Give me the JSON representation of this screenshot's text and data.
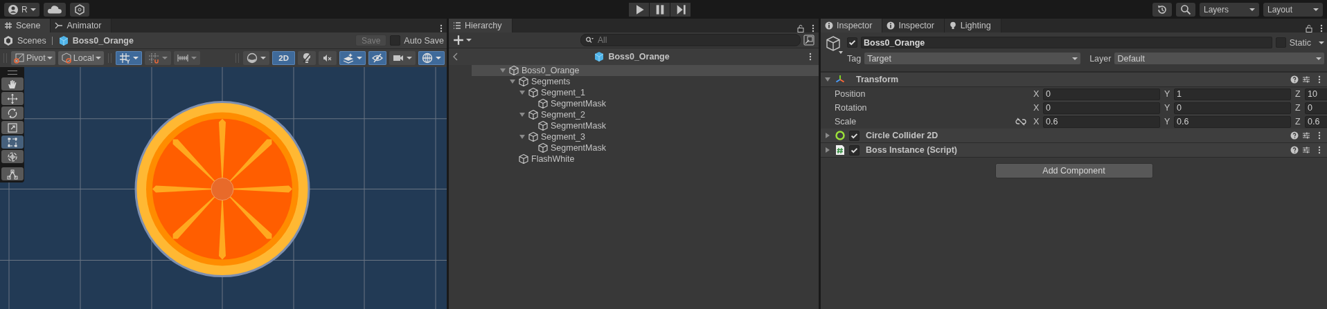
{
  "top_bar": {
    "account": "R",
    "layers": "Layers",
    "layout": "Layout"
  },
  "scene": {
    "tabs": [
      {
        "label": "Scene",
        "kind": "grid",
        "selected": true
      },
      {
        "label": "Animator",
        "kind": "animator",
        "selected": false
      }
    ],
    "breadcrumb": [
      "Scenes",
      "Boss0_Orange"
    ],
    "save": "Save",
    "auto_save": {
      "label": "Auto Save",
      "checked": false
    },
    "pivot": "Pivot",
    "local": "Local",
    "snap_toggles": [
      {
        "kind": "grid-snap",
        "on": true
      },
      {
        "kind": "increment-snap",
        "on": false
      },
      {
        "kind": "grid-ruler",
        "on": false
      }
    ],
    "view_toggles": [
      {
        "kind": "shading",
        "on": false
      },
      {
        "kind": "mode",
        "label": "2D",
        "on": true
      },
      {
        "kind": "lighting",
        "on": false
      },
      {
        "kind": "audio",
        "on": false
      },
      {
        "kind": "effects",
        "on": true
      },
      {
        "kind": "visibility",
        "on": true
      },
      {
        "kind": "camera",
        "on": false
      },
      {
        "kind": "gizmos",
        "on": true
      }
    ],
    "tools": [
      {
        "kind": "hand",
        "selected": false
      },
      {
        "kind": "move",
        "selected": false
      },
      {
        "kind": "rotate",
        "selected": false
      },
      {
        "kind": "scale",
        "selected": false
      },
      {
        "kind": "rect",
        "selected": true
      },
      {
        "kind": "transform",
        "selected": false
      },
      {
        "kind": "custom",
        "selected": false
      }
    ]
  },
  "hierarchy": {
    "tabs": [
      {
        "label": "Hierarchy",
        "selected": true
      }
    ],
    "search": {
      "placeholder": "All"
    },
    "prefab_title": "Boss0_Orange",
    "tree": [
      {
        "name": "Boss0_Orange",
        "selected": true,
        "expanded": true,
        "children": [
          {
            "name": "Segments",
            "selected": false,
            "expanded": true,
            "children": [
              {
                "name": "Segment_1",
                "selected": false,
                "expanded": true,
                "children": [
                  {
                    "name": "SegmentMask",
                    "selected": false
                  }
                ]
              },
              {
                "name": "Segment_2",
                "selected": false,
                "expanded": true,
                "children": [
                  {
                    "name": "SegmentMask",
                    "selected": false
                  }
                ]
              },
              {
                "name": "Segment_3",
                "selected": false,
                "expanded": true,
                "children": [
                  {
                    "name": "SegmentMask",
                    "selected": false
                  }
                ]
              }
            ]
          },
          {
            "name": "FlashWhite",
            "selected": false
          }
        ]
      }
    ]
  },
  "inspector": {
    "tabs": [
      {
        "label": "Inspector",
        "kind": "info",
        "selected": true
      },
      {
        "label": "Inspector",
        "kind": "info",
        "selected": false
      },
      {
        "label": "Lighting",
        "kind": "bulb",
        "selected": false
      }
    ],
    "object": {
      "active": true,
      "name": "Boss0_Orange",
      "static": {
        "label": "Static",
        "checked": false
      },
      "tag_label": "Tag",
      "tag": "Target",
      "layer_label": "Layer",
      "layer": "Default"
    },
    "transform": {
      "title": "Transform",
      "expanded": true,
      "rows": [
        {
          "label": "Position",
          "linked": false,
          "values": [
            {
              "axis": "X",
              "value": "0"
            },
            {
              "axis": "Y",
              "value": "1"
            },
            {
              "axis": "Z",
              "value": "10"
            }
          ]
        },
        {
          "label": "Rotation",
          "linked": false,
          "values": [
            {
              "axis": "X",
              "value": "0"
            },
            {
              "axis": "Y",
              "value": "0"
            },
            {
              "axis": "Z",
              "value": "0"
            }
          ]
        },
        {
          "label": "Scale",
          "linked": true,
          "values": [
            {
              "axis": "X",
              "value": "0.6"
            },
            {
              "axis": "Y",
              "value": "0.6"
            },
            {
              "axis": "Z",
              "value": "0.6"
            }
          ]
        }
      ]
    },
    "components": [
      {
        "title": "Circle Collider 2D",
        "kind": "collider",
        "enabled": true,
        "expanded": false
      },
      {
        "title": "Boss Instance (Script)",
        "kind": "script",
        "enabled": true,
        "expanded": false
      }
    ],
    "add_component": "Add Component"
  }
}
